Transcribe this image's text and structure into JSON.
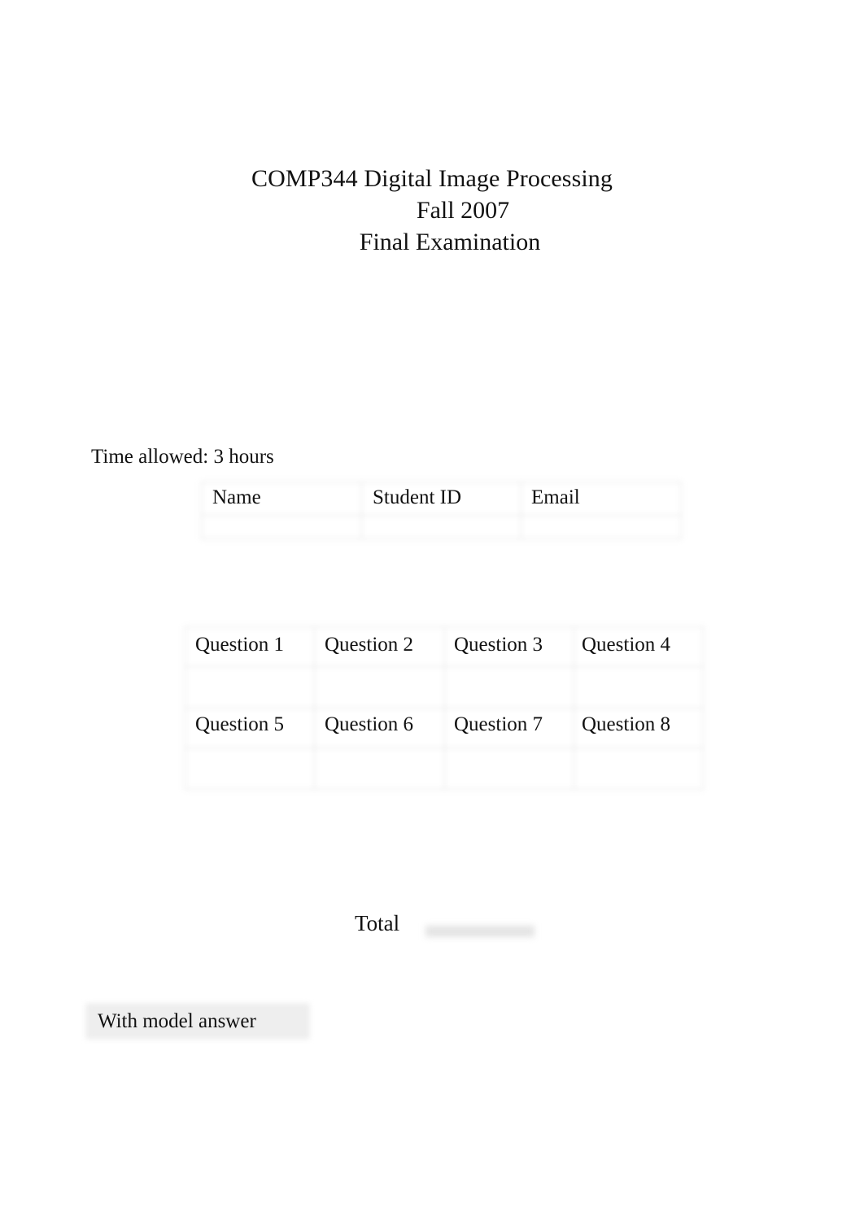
{
  "document": {
    "title_lines": [
      "COMP344 Digital Image Processing",
      "Fall 2007",
      "Final Examination"
    ],
    "time_allowed": "Time allowed: 3 hours"
  },
  "info_table": {
    "headers": [
      "Name",
      "Student ID",
      "Email"
    ],
    "values": [
      "",
      "",
      ""
    ]
  },
  "questions_table": {
    "rows": [
      {
        "headers": [
          "Question 1",
          "Question 2",
          "Question 3",
          "Question 4"
        ],
        "values": [
          "",
          "",
          "",
          ""
        ]
      },
      {
        "headers": [
          "Question 5",
          "Question 6",
          "Question 7",
          "Question 8"
        ],
        "values": [
          "",
          "",
          "",
          ""
        ]
      }
    ]
  },
  "total": {
    "label": "Total",
    "value": ""
  },
  "footer": {
    "model_answer_label": "With model answer"
  },
  "colors": {
    "page_background": "#ffffff",
    "text": "#111111",
    "table_border": "#dedede",
    "highlight_box": "#eeeeee",
    "rule": "#e4e4e4"
  }
}
